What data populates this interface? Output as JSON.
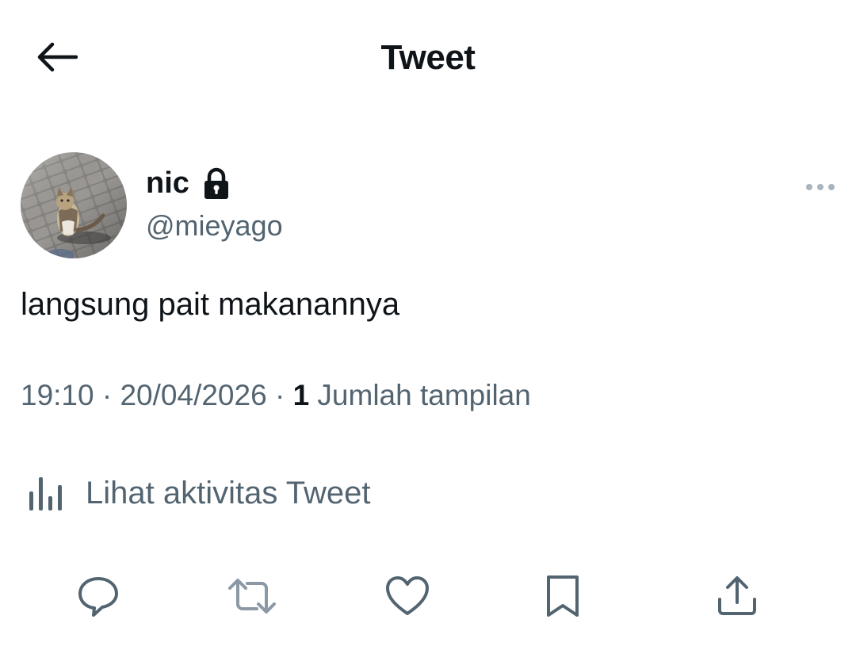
{
  "header": {
    "title": "Tweet",
    "back_icon": "arrow-left-icon"
  },
  "author": {
    "display_name": "nic",
    "handle": "@mieyago",
    "protected_icon": "lock-icon",
    "avatar": "cat-photo-avatar",
    "more_icon": "more-horizontal-icon"
  },
  "tweet": {
    "text": "langsung pait makanannya",
    "time": "19:10",
    "separator": " · ",
    "date": "20/04/2026",
    "views_count": "1",
    "views_label": " Jumlah tampilan"
  },
  "activity": {
    "label": "Lihat aktivitas Tweet",
    "icon": "analytics-bar-icon"
  },
  "actions": [
    {
      "icon": "reply-icon"
    },
    {
      "icon": "retweet-icon"
    },
    {
      "icon": "like-icon"
    },
    {
      "icon": "bookmark-icon"
    },
    {
      "icon": "share-icon"
    }
  ],
  "colors": {
    "text_primary": "#0f1419",
    "text_secondary": "#536471",
    "icon_disabled": "#8b98a5"
  }
}
